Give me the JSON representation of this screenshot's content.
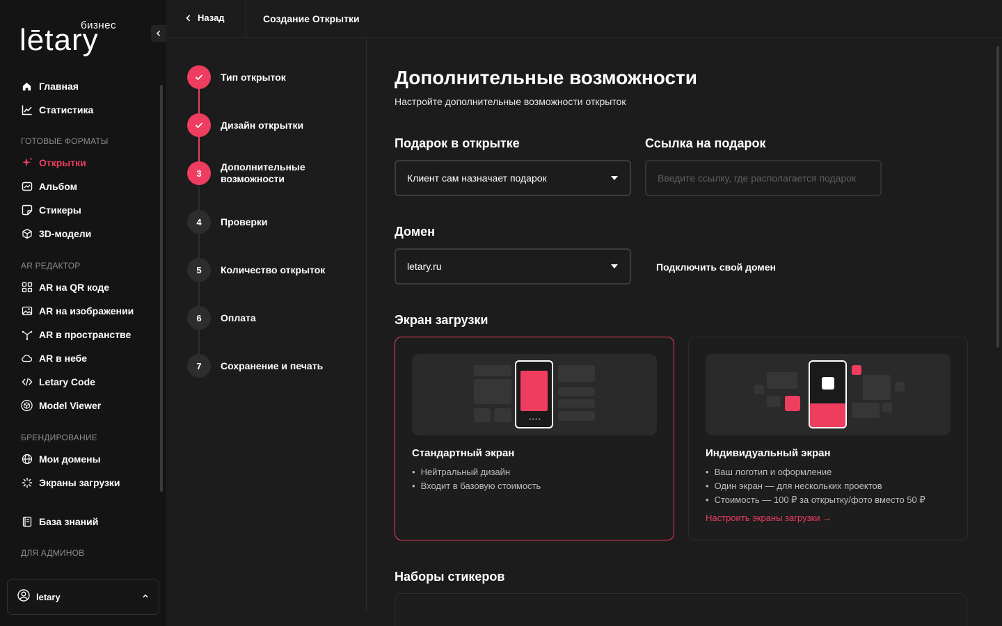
{
  "sidebar": {
    "logo": {
      "tagline": "бизнес",
      "wordmark": "lētary"
    },
    "items_top": [
      {
        "label": "Главная",
        "icon": "home-icon"
      },
      {
        "label": "Статистика",
        "icon": "chart-line-icon"
      }
    ],
    "section_ready": "ГОТОВЫЕ ФОРМАТЫ",
    "items_ready": [
      {
        "label": "Открытки",
        "icon": "sparkle-icon",
        "active": true
      },
      {
        "label": "Альбом",
        "icon": "album-icon"
      },
      {
        "label": "Стикеры",
        "icon": "sticker-icon"
      },
      {
        "label": "3D-модели",
        "icon": "cube-icon"
      }
    ],
    "section_ar": "AR РЕДАКТОР",
    "items_ar": [
      {
        "label": "AR на QR коде",
        "icon": "qr-icon"
      },
      {
        "label": "AR на изображении",
        "icon": "image-icon"
      },
      {
        "label": "AR в пространстве",
        "icon": "space-icon"
      },
      {
        "label": "AR в небе",
        "icon": "cloud-icon"
      },
      {
        "label": "Letary Code",
        "icon": "code-icon"
      },
      {
        "label": "Model Viewer",
        "icon": "model-viewer-icon"
      }
    ],
    "section_brand": "БРЕНДИРОВАНИЕ",
    "items_brand": [
      {
        "label": "Мои домены",
        "icon": "globe-icon"
      },
      {
        "label": "Экраны загрузки",
        "icon": "loader-icon"
      }
    ],
    "knowledge": {
      "label": "База знаний",
      "icon": "book-icon"
    },
    "section_admin": "ДЛЯ АДМИНОВ",
    "account": {
      "name": "letary"
    }
  },
  "topbar": {
    "back_label": "Назад",
    "title": "Создание Открытки"
  },
  "steps": [
    {
      "number": "1",
      "label": "Тип открыток",
      "state": "done"
    },
    {
      "number": "2",
      "label": "Дизайн открытки",
      "state": "done"
    },
    {
      "number": "3",
      "label": "Дополнительные возможности",
      "state": "current"
    },
    {
      "number": "4",
      "label": "Проверки",
      "state": "todo"
    },
    {
      "number": "5",
      "label": "Количество открыток",
      "state": "todo"
    },
    {
      "number": "6",
      "label": "Оплата",
      "state": "todo"
    },
    {
      "number": "7",
      "label": "Сохранение и печать",
      "state": "todo"
    }
  ],
  "main": {
    "title": "Дополнительные возможности",
    "subtitle": "Настройте дополнительные возможности открыток",
    "gift": {
      "heading": "Подарок в открытке",
      "select_value": "Клиент сам назначает подарок"
    },
    "gift_link": {
      "heading": "Ссылка на подарок",
      "placeholder": "Введите ссылку, где располагается подарок"
    },
    "domain": {
      "heading": "Домен",
      "select_value": "letary.ru",
      "connect_label": "Подключить свой домен"
    },
    "loading": {
      "heading": "Экран загрузки",
      "standard": {
        "title": "Стандартный экран",
        "bullets": [
          "Нейтральный дизайн",
          "Входит в базовую стоимость"
        ],
        "selected": true
      },
      "custom": {
        "title": "Индивидуальный экран",
        "bullets": [
          "Ваш логотип и оформление",
          "Один экран — для нескольких проектов",
          "Стоимость — 100 ₽ за открытку/фото вместо 50 ₽"
        ],
        "link": "Настроить экраны загрузки →"
      }
    },
    "stickers": {
      "heading": "Наборы стикеров"
    }
  },
  "colors": {
    "accent": "#ee3d5f",
    "background": "#1c1c1c",
    "sidebar": "#141414"
  }
}
